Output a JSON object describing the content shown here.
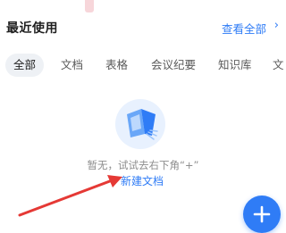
{
  "header": {
    "title": "最近使用",
    "view_all_label": "查看全部",
    "view_all_chevron": "›"
  },
  "tabs": [
    {
      "label": "全部",
      "active": true
    },
    {
      "label": "文档",
      "active": false
    },
    {
      "label": "表格",
      "active": false
    },
    {
      "label": "会议纪要",
      "active": false
    },
    {
      "label": "知识库",
      "active": false
    },
    {
      "label": "文",
      "active": false
    }
  ],
  "empty_state": {
    "message": "暂无，试试去右下角“+”",
    "link_label": "新建文档"
  },
  "colors": {
    "accent": "#2f7cf6",
    "annotation": "#e53935"
  },
  "icons": {
    "fab": "plus-icon",
    "illustration": "empty-folder-illustration-icon"
  }
}
